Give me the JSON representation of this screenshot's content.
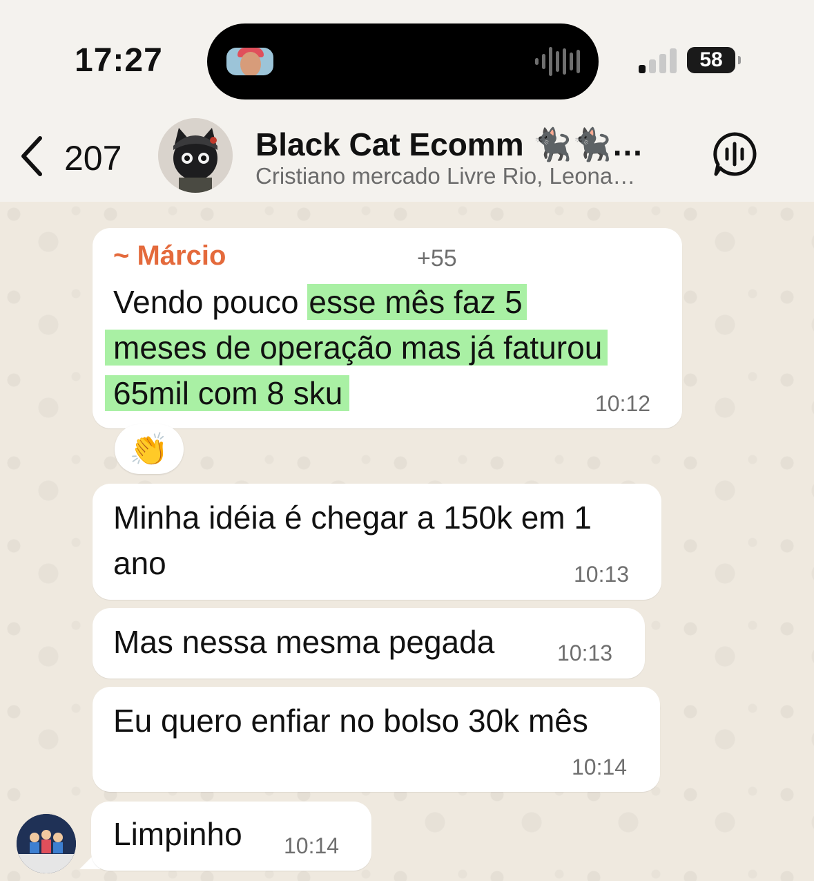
{
  "status_bar": {
    "time": "17:27",
    "battery": "58"
  },
  "header": {
    "back_count": "207",
    "title": "Black Cat Ecomm 🐈‍⬛🐈‍⬛…",
    "subtitle": "Cristiano mercado Livre Rio, Leona…"
  },
  "messages": [
    {
      "sender": "~ Márcio",
      "phone": "+55",
      "line1_plain": "Vendo pouco ",
      "line1_hl": "esse mês faz 5",
      "line2_hl": "meses de operação mas já faturou",
      "line3_hl": "65mil com 8 sku",
      "time": "10:12",
      "reaction": "👏"
    },
    {
      "line1": "Minha idéia é chegar a 150k em 1",
      "line2": "ano",
      "time": "10:13"
    },
    {
      "text": "Mas nessa mesma pegada",
      "time": "10:13"
    },
    {
      "text": "Eu quero enfiar no bolso 30k mês",
      "time": "10:14"
    },
    {
      "text": "Limpinho",
      "time": "10:14"
    }
  ],
  "colors": {
    "sender_name": "#e46a3c",
    "highlight": "#a9f0a4",
    "bubble": "#ffffff",
    "wallpaper": "#efe9df"
  }
}
